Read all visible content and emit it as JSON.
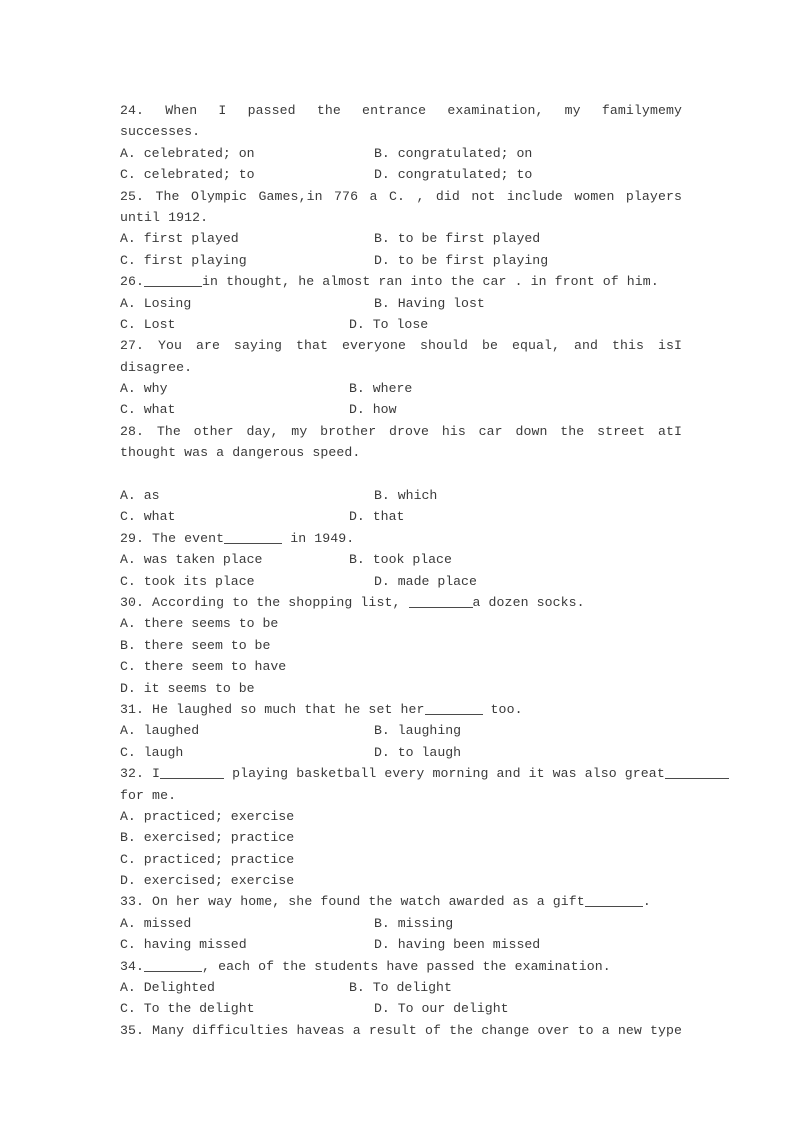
{
  "document": {
    "type": "multiple-choice-grammar-worksheet",
    "page_background": "#ffffff",
    "text_color": "#3a3a3a"
  },
  "questions": [
    {
      "number": "24.",
      "stem_lines": [
        "24.  When  I  passed  the  entrance  examination,  my  family____ me ____my",
        "successes."
      ],
      "stem_part_1": "24.  When  I  passed  the  entrance  examination,  my  family",
      "stem_part_2": "me",
      "stem_part_3": "my",
      "stem_cont": "successes.",
      "options": [
        {
          "key": "A.",
          "text": "celebrated; on"
        },
        {
          "key": "B.",
          "text": "congratulated; on"
        },
        {
          "key": "C.",
          "text": "celebrated; to"
        },
        {
          "key": "D.",
          "text": "congratulated; to"
        }
      ]
    },
    {
      "number": "25.",
      "stem_part_1": "25.  The  Olympic  Games,",
      "stem_part_2": "in  776  a  C.  ,  did  not  include  women  players",
      "stem_cont": "until 1912.",
      "options": [
        {
          "key": "A.",
          "text": "first played"
        },
        {
          "key": "B.",
          "text": "to be first played"
        },
        {
          "key": "C.",
          "text": "first playing"
        },
        {
          "key": "D.",
          "text": "to be first playing"
        }
      ]
    },
    {
      "number": "26.",
      "stem_part_1": "26.",
      "stem_part_2": "in thought, he almost ran into the car . in front of him.",
      "options": [
        {
          "key": "A.",
          "text": "Losing"
        },
        {
          "key": "B.",
          "text": "Having lost"
        },
        {
          "key": "C.",
          "text": "Lost"
        },
        {
          "key": "D.",
          "text": "To lose"
        }
      ]
    },
    {
      "number": "27.",
      "stem_part_1": "27.  You  are  saying  that  everyone  should  be  equal,  and  this  is",
      "stem_part_2": "I",
      "stem_cont": "disagree.",
      "options": [
        {
          "key": "A.",
          "text": "why"
        },
        {
          "key": "B.",
          "text": "where"
        },
        {
          "key": "C.",
          "text": "what"
        },
        {
          "key": "D.",
          "text": "how"
        }
      ]
    },
    {
      "number": "28.",
      "stem_part_1": "28.  The  other  day,  my  brother  drove  his  car  down  the  street  at",
      "stem_part_2": "I",
      "stem_cont": "thought was a dangerous speed.",
      "options": [
        {
          "key": "A.",
          "text": "as"
        },
        {
          "key": "B.",
          "text": "which"
        },
        {
          "key": "C.",
          "text": "what"
        },
        {
          "key": "D.",
          "text": "that"
        }
      ]
    },
    {
      "number": "29.",
      "stem_part_1": "29. The event",
      "stem_part_2": "in 1949.",
      "options": [
        {
          "key": "A.",
          "text": "was taken place"
        },
        {
          "key": "B.",
          "text": "took place"
        },
        {
          "key": "C.",
          "text": "took its place"
        },
        {
          "key": "D.",
          "text": "made place"
        }
      ]
    },
    {
      "number": "30.",
      "stem_part_1": "30. According to the shopping list,",
      "stem_part_2": "a dozen socks.",
      "options": [
        {
          "key": "A.",
          "text": "there seems to be"
        },
        {
          "key": "B.",
          "text": "there seem to be"
        },
        {
          "key": "C.",
          "text": "there seem to have"
        },
        {
          "key": "D.",
          "text": "it seems to be"
        }
      ]
    },
    {
      "number": "31.",
      "stem_part_1": "31. He laughed so much that he set her",
      "stem_part_2": "too.",
      "options": [
        {
          "key": "A.",
          "text": "laughed"
        },
        {
          "key": "B.",
          "text": "laughing"
        },
        {
          "key": "C.",
          "text": "laugh"
        },
        {
          "key": "D.",
          "text": "to laugh"
        }
      ]
    },
    {
      "number": "32.",
      "stem_part_1": "32. I",
      "stem_part_2": "playing basketball every morning and it was also great",
      "stem_cont": "for me.",
      "options": [
        {
          "key": "A.",
          "text": "practiced; exercise"
        },
        {
          "key": "B.",
          "text": "exercised; practice"
        },
        {
          "key": "C.",
          "text": "practiced; practice"
        },
        {
          "key": "D.",
          "text": "exercised; exercise"
        }
      ]
    },
    {
      "number": "33.",
      "stem_part_1": "33. On her way home, she found the watch awarded as a gift",
      "stem_part_2": ".",
      "options": [
        {
          "key": "A.",
          "text": "missed"
        },
        {
          "key": "B.",
          "text": "missing"
        },
        {
          "key": "C.",
          "text": "having missed"
        },
        {
          "key": "D.",
          "text": "having been missed"
        }
      ]
    },
    {
      "number": "34.",
      "stem_part_1": "34.",
      "stem_part_2": ", each of the students have passed the examination.",
      "options": [
        {
          "key": "A.",
          "text": "Delighted"
        },
        {
          "key": "B.",
          "text": "To delight"
        },
        {
          "key": "C.",
          "text": "To the delight"
        },
        {
          "key": "D.",
          "text": "To our delight"
        }
      ]
    },
    {
      "number": "35.",
      "stem_part_1": "35. Many difficulties have",
      "stem_part_2": "as a result of the change over to a new type",
      "options": []
    }
  ]
}
